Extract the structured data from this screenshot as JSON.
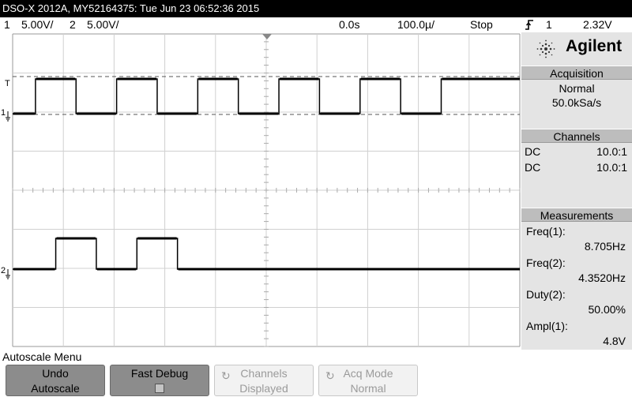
{
  "title_bar": {
    "text": "DSO-X 2012A, MY52164375: Tue Jun 23 06:52:36 2015"
  },
  "status_row": {
    "ch1_num": "1",
    "ch1_scale": "5.00V/",
    "ch2_num": "2",
    "ch2_scale": "5.00V/",
    "time_delay": "0.0s",
    "time_scale": "100.0µ/",
    "run_state": "Stop",
    "trigger_icon": "rising-edge-trigger-icon",
    "trigger_source": "1",
    "trigger_level": "2.32V"
  },
  "screen": {
    "background": "#ffffff",
    "grid_color": "#d0d0d0",
    "trace_color": "#000000",
    "markers": {
      "trigger_level": "T",
      "ch1_ground": "1",
      "ch2_ground": "2"
    },
    "ch1": {
      "description": "square wave, high/low transitions",
      "transitions_divisions": [
        0.45,
        1.25,
        2.05,
        2.85,
        3.65,
        4.45,
        5.25,
        6.05,
        6.85,
        7.65,
        8.45
      ]
    },
    "ch2": {
      "description": "square wave at half frequency, two pulses then flat low",
      "pulses_divisions": [
        [
          0.85,
          1.65
        ],
        [
          2.45,
          3.25
        ]
      ]
    }
  },
  "sidebar": {
    "brand": {
      "name": "Agilent",
      "logo_icon": "agilent-spark-icon"
    },
    "acquisition": {
      "header": "Acquisition",
      "mode": "Normal",
      "rate": "50.0kSa/s"
    },
    "channels": {
      "header": "Channels",
      "rows": [
        {
          "coupling": "DC",
          "probe": "10.0:1"
        },
        {
          "coupling": "DC",
          "probe": "10.0:1"
        }
      ]
    },
    "measurements": {
      "header": "Measurements",
      "items": [
        {
          "label": "Freq(1):",
          "value": "8.705Hz"
        },
        {
          "label": "Freq(2):",
          "value": "4.3520Hz"
        },
        {
          "label": "Duty(2):",
          "value": "50.00%"
        },
        {
          "label": "Ampl(1):",
          "value": "4.8V"
        }
      ]
    }
  },
  "menu": {
    "title": "Autoscale Menu",
    "softkeys": [
      {
        "line1": "Undo",
        "line2": "Autoscale",
        "state": "active"
      },
      {
        "line1": "Fast Debug",
        "line2": "",
        "state": "active",
        "checkbox": true
      },
      {
        "line1": "Channels",
        "line2": "Displayed",
        "state": "inactive"
      },
      {
        "line1": "Acq Mode",
        "line2": "Normal",
        "state": "inactive"
      }
    ]
  }
}
